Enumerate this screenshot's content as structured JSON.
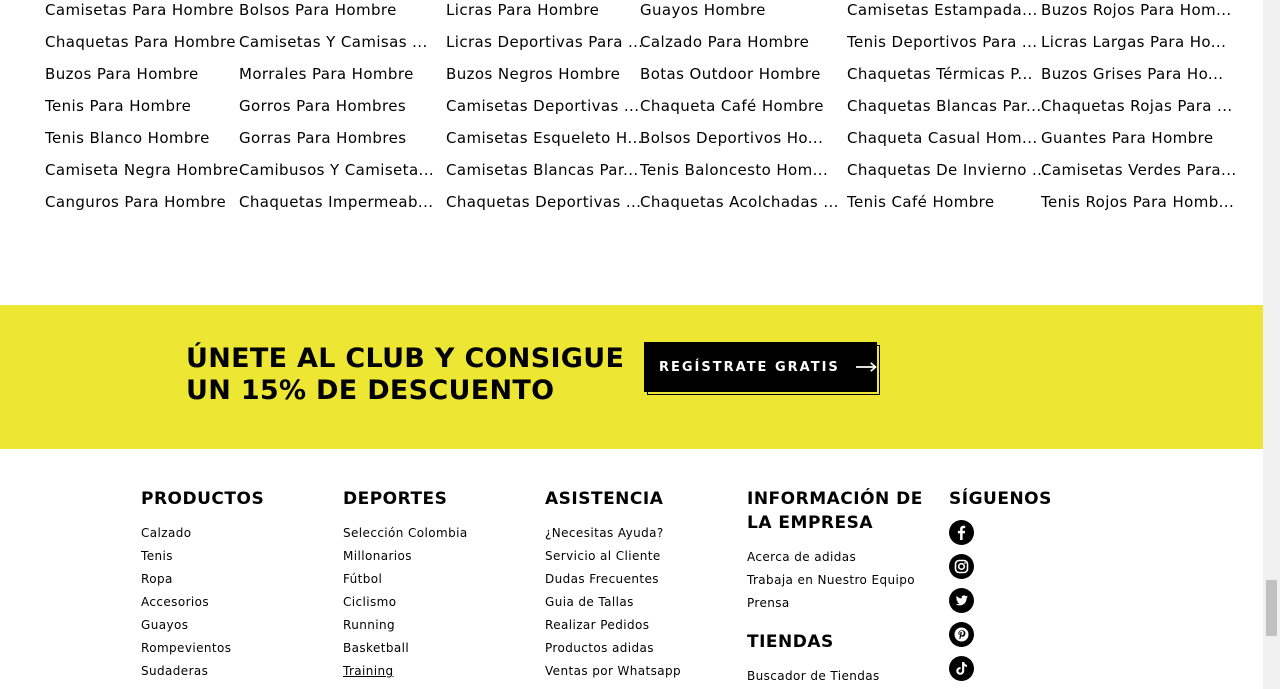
{
  "link_columns": [
    [
      "Camisetas Para Hombre",
      "Chaquetas Para Hombre",
      "Buzos Para Hombre",
      "Tenis Para Hombre",
      "Tenis Blanco Hombre",
      "Camiseta Negra Hombre",
      "Canguros Para Hombre"
    ],
    [
      "Bolsos Para Hombre",
      "Camisetas Y Camisas ...",
      "Morrales Para Hombre",
      "Gorros Para Hombres",
      "Gorras Para Hombres",
      "Camibusos Y Camiseta...",
      "Chaquetas Impermeab..."
    ],
    [
      "Licras Para Hombre",
      "Licras Deportivas Para ...",
      "Buzos Negros Hombre",
      "Camisetas Deportivas ...",
      "Camisetas Esqueleto H...",
      "Camisetas Blancas Par...",
      "Chaquetas Deportivas ..."
    ],
    [
      "Guayos Hombre",
      "Calzado Para Hombre",
      "Botas Outdoor Hombre",
      "Chaqueta Café Hombre",
      "Bolsos Deportivos Ho...",
      "Tenis Baloncesto Hom...",
      "Chaquetas Acolchadas ..."
    ],
    [
      "Camisetas Estampada...",
      "Tenis Deportivos Para ...",
      "Chaquetas Térmicas P...",
      "Chaquetas Blancas Par...",
      "Chaqueta Casual Hom...",
      "Chaquetas De Invierno ...",
      "Tenis Café Hombre"
    ],
    [
      "Buzos Rojos Para Hom...",
      "Licras Largas Para Ho...",
      "Buzos Grises Para Ho...",
      "Chaquetas Rojas Para ...",
      "Guantes Para Hombre",
      "Camisetas Verdes Para...",
      "Tenis Rojos Para Homb..."
    ]
  ],
  "promo": {
    "title_line1": "ÚNETE AL CLUB Y CONSIGUE",
    "title_line2": "UN 15% DE DESCUENTO",
    "button_label": "REGÍSTRATE GRATIS",
    "button_icon": "arrow-right-icon",
    "background_color": "#ede734"
  },
  "footer": {
    "productos": {
      "heading": "PRODUCTOS",
      "links": [
        "Calzado",
        "Tenis",
        "Ropa",
        "Accesorios",
        "Guayos",
        "Rompevientos",
        "Sudaderas"
      ]
    },
    "deportes": {
      "heading": "DEPORTES",
      "links": [
        "Selección Colombia",
        "Millonarios",
        "Fútbol",
        "Ciclismo",
        "Running",
        "Basketball",
        "Training"
      ]
    },
    "asistencia": {
      "heading": "ASISTENCIA",
      "links": [
        "¿Necesitas Ayuda?",
        "Servicio al Cliente",
        "Dudas Frecuentes",
        "Guia de Tallas",
        "Realizar Pedidos",
        "Productos adidas",
        "Ventas por Whatsapp"
      ]
    },
    "empresa": {
      "heading_line1": "INFORMACIÓN DE",
      "heading_line2": "LA EMPRESA",
      "links": [
        "Acerca de adidas",
        "Trabaja en Nuestro Equipo",
        "Prensa"
      ]
    },
    "tiendas": {
      "heading": "TIENDAS",
      "links": [
        "Buscador de Tiendas"
      ]
    },
    "siguenos": {
      "heading": "SÍGUENOS",
      "icons": [
        "facebook-icon",
        "instagram-icon",
        "twitter-icon",
        "pinterest-icon",
        "tiktok-icon"
      ]
    }
  }
}
